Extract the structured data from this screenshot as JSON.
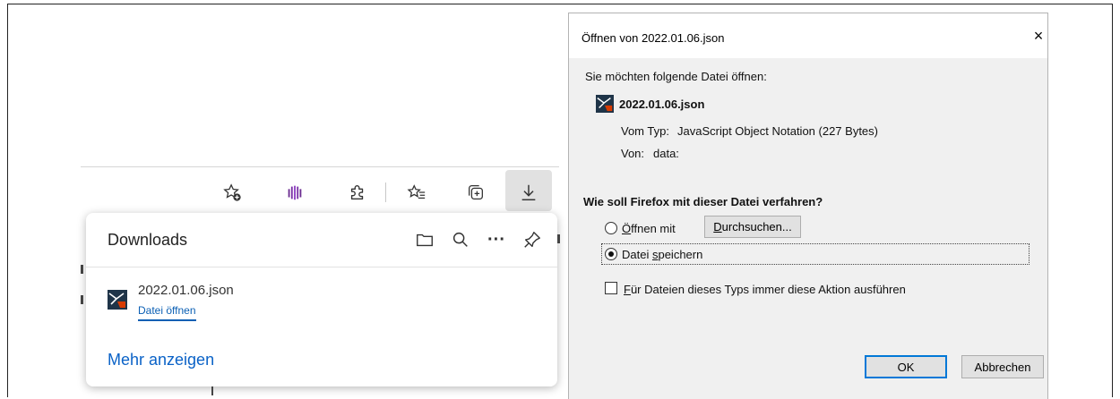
{
  "edge": {
    "toolbar": {
      "icons": [
        "favorite-add-icon",
        "extension-app-icon",
        "extensions-puzzle-icon",
        "favorites-icon",
        "collections-icon",
        "download-icon"
      ]
    },
    "downloads_panel": {
      "title": "Downloads",
      "header_icons": [
        "folder-icon",
        "search-icon",
        "more-icon",
        "pin-icon"
      ],
      "more_glyph": "···",
      "items": [
        {
          "filename": "2022.01.06.json",
          "action_label": "Datei öffnen"
        }
      ],
      "show_more_label": "Mehr anzeigen"
    }
  },
  "dialog": {
    "title": "Öffnen von 2022.01.06.json",
    "close_glyph": "×",
    "prompt": "Sie möchten folgende Datei öffnen:",
    "filename": "2022.01.06.json",
    "type_label": "Vom Typ:",
    "type_value": "JavaScript Object Notation (227 Bytes)",
    "from_label": "Von:",
    "from_value": "data:",
    "question": "Wie soll Firefox mit dieser Datei verfahren?",
    "open_with": {
      "accel": "Ö",
      "label_rest": "ffnen mit",
      "checked": false
    },
    "browse_button": {
      "accel": "D",
      "label_rest": "urchsuchen..."
    },
    "save_file": {
      "label_pre": "Datei ",
      "accel": "s",
      "label_rest": "peichern",
      "checked": true
    },
    "always_checkbox": {
      "accel": "F",
      "label_rest": "ür Dateien dieses Typs immer diese Aktion ausführen",
      "checked": false
    },
    "ok_label": "OK",
    "cancel_label": "Abbrechen"
  },
  "colors": {
    "link": "#0a5fb4",
    "accent": "#0078d7",
    "dialog_bg": "#f0f0f0"
  }
}
